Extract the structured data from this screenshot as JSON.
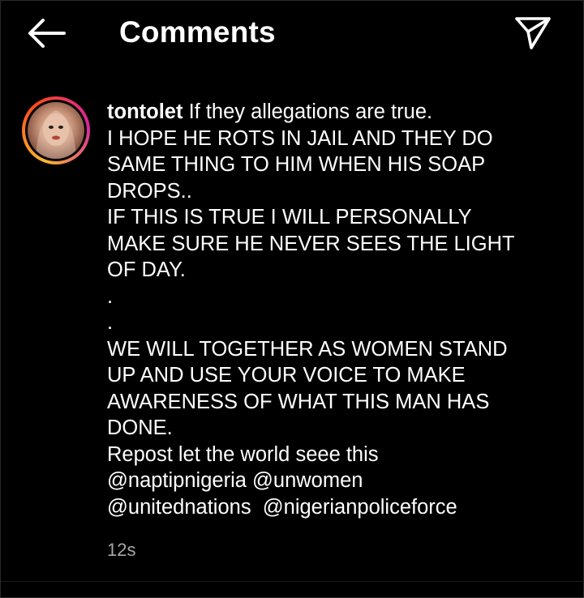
{
  "header": {
    "title": "Comments",
    "back_icon": "arrow-left-icon",
    "share_icon": "paper-plane-icon"
  },
  "comment": {
    "username": "tontolet",
    "lines": [
      "If they allegations are true.",
      "I HOPE HE ROTS IN JAIL AND THEY DO",
      "SAME THING TO HIM WHEN HIS SOAP",
      "DROPS..",
      "IF THIS IS TRUE I WILL PERSONALLY",
      "MAKE SURE HE NEVER SEES THE LIGHT",
      "OF DAY.",
      ".",
      ".",
      "WE WILL TOGETHER AS WOMEN STAND",
      "UP AND USE YOUR VOICE TO MAKE",
      "AWARENESS OF WHAT THIS MAN HAS",
      "DONE.",
      "Repost let the world seee this"
    ],
    "mentions": [
      "@naptipnigeria",
      "@unwomen",
      "@unitednations",
      "@nigerianpoliceforce"
    ],
    "timestamp": "12s"
  }
}
